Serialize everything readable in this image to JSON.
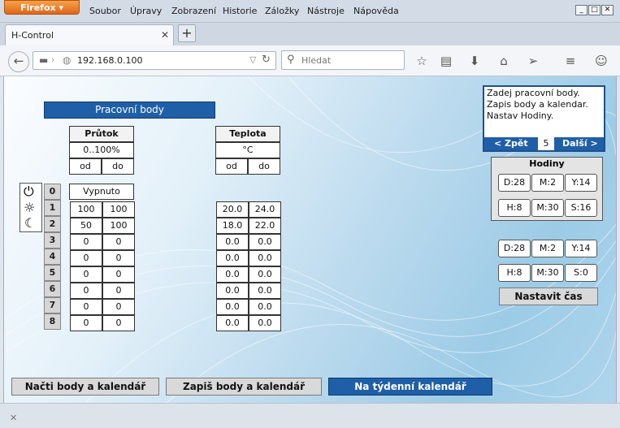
{
  "browser": {
    "menu_button": "Firefox",
    "menu": [
      "Soubor",
      "Úpravy",
      "Zobrazení",
      "Historie",
      "Záložky",
      "Nástroje",
      "Nápověda"
    ],
    "tab_title": "H-Control",
    "url": "192.168.0.100",
    "search_placeholder": "Hledat"
  },
  "app": {
    "title_bar": "Pracovní body",
    "flow": {
      "header": "Průtok",
      "unit": "0..100%",
      "from": "od",
      "to": "do"
    },
    "temp": {
      "header": "Teplota",
      "unit": "°C",
      "from": "od",
      "to": "do"
    },
    "row0_label": "Vypnuto",
    "rows": [
      {
        "n": "0"
      },
      {
        "n": "1",
        "f_od": "100",
        "f_do": "100",
        "t_od": "20.0",
        "t_do": "24.0"
      },
      {
        "n": "2",
        "f_od": "50",
        "f_do": "100",
        "t_od": "18.0",
        "t_do": "22.0"
      },
      {
        "n": "3",
        "f_od": "0",
        "f_do": "0",
        "t_od": "0.0",
        "t_do": "0.0"
      },
      {
        "n": "4",
        "f_od": "0",
        "f_do": "0",
        "t_od": "0.0",
        "t_do": "0.0"
      },
      {
        "n": "5",
        "f_od": "0",
        "f_do": "0",
        "t_od": "0.0",
        "t_do": "0.0"
      },
      {
        "n": "6",
        "f_od": "0",
        "f_do": "0",
        "t_od": "0.0",
        "t_do": "0.0"
      },
      {
        "n": "7",
        "f_od": "0",
        "f_do": "0",
        "t_od": "0.0",
        "t_do": "0.0"
      },
      {
        "n": "8",
        "f_od": "0",
        "f_do": "0",
        "t_od": "0.0",
        "t_do": "0.0"
      }
    ],
    "instructions": [
      "Zadej pracovní body.",
      "Zapis body a kalendar.",
      "Nastav Hodiny."
    ],
    "step": {
      "prev": "< Zpět",
      "value": "5",
      "next": "Další >"
    },
    "clock": {
      "title": "Hodiny",
      "current": {
        "d": "D:28",
        "m": "M:2",
        "y": "Y:14",
        "h": "H:8",
        "mi": "M:30",
        "s": "S:16"
      },
      "set": {
        "d": "D:28",
        "m": "M:2",
        "y": "Y:14",
        "h": "H:8",
        "mi": "M:30",
        "s": "S:0"
      },
      "set_button": "Nastavit čas"
    },
    "buttons": {
      "load": "Načti body a kalendář",
      "write": "Zapiš body a kalendář",
      "weekly": "Na týdenní kalendář"
    }
  }
}
